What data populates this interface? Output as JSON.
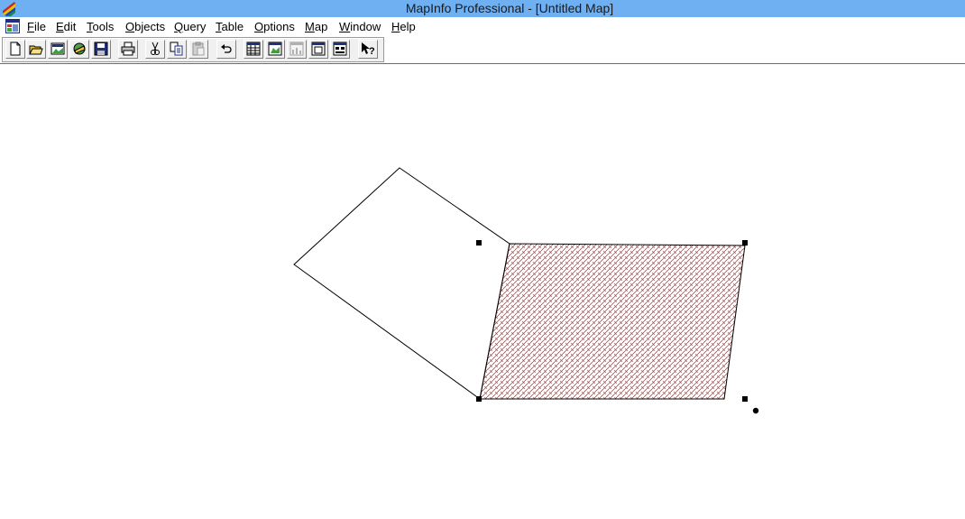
{
  "window": {
    "title": "MapInfo Professional - [Untitled Map]"
  },
  "menu": {
    "items": [
      {
        "label": "File"
      },
      {
        "label": "Edit"
      },
      {
        "label": "Tools"
      },
      {
        "label": "Objects"
      },
      {
        "label": "Query"
      },
      {
        "label": "Table"
      },
      {
        "label": "Options"
      },
      {
        "label": "Map"
      },
      {
        "label": "Window"
      },
      {
        "label": "Help"
      }
    ]
  },
  "toolbar": {
    "buttons": [
      {
        "icon": "new-icon"
      },
      {
        "icon": "open-icon"
      },
      {
        "icon": "open-workspace-icon"
      },
      {
        "icon": "open-dbms-icon"
      },
      {
        "icon": "save-icon"
      },
      {
        "icon": "print-icon"
      },
      {
        "icon": "cut-icon"
      },
      {
        "icon": "copy-icon"
      },
      {
        "icon": "paste-icon"
      },
      {
        "icon": "undo-icon"
      },
      {
        "icon": "browser-window-icon"
      },
      {
        "icon": "map-window-icon"
      },
      {
        "icon": "graph-window-icon"
      },
      {
        "icon": "layout-window-icon"
      },
      {
        "icon": "redistrict-window-icon"
      },
      {
        "icon": "help-icon"
      }
    ]
  },
  "map": {
    "polygon_outline_color": "#000000",
    "selected_fill_color": "#e03030",
    "background_color": "#ffffff"
  }
}
